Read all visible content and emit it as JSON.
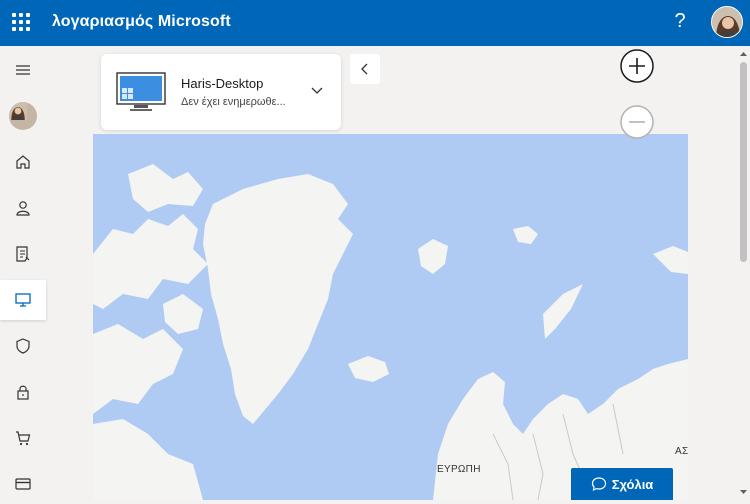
{
  "header": {
    "title": "λογαριασμός Microsoft",
    "help_label": "?"
  },
  "device": {
    "name": "Haris-Desktop",
    "status": "Δεν έχει ενημερωθε..."
  },
  "map": {
    "label_europe": "ΕΥΡΩΠΗ",
    "label_asia": "ΑΣ"
  },
  "feedback": {
    "label": "Σχόλια"
  },
  "colors": {
    "brand_blue": "#0067b8",
    "map_water": "#b0cbf3",
    "map_land": "#f4f4f2"
  }
}
